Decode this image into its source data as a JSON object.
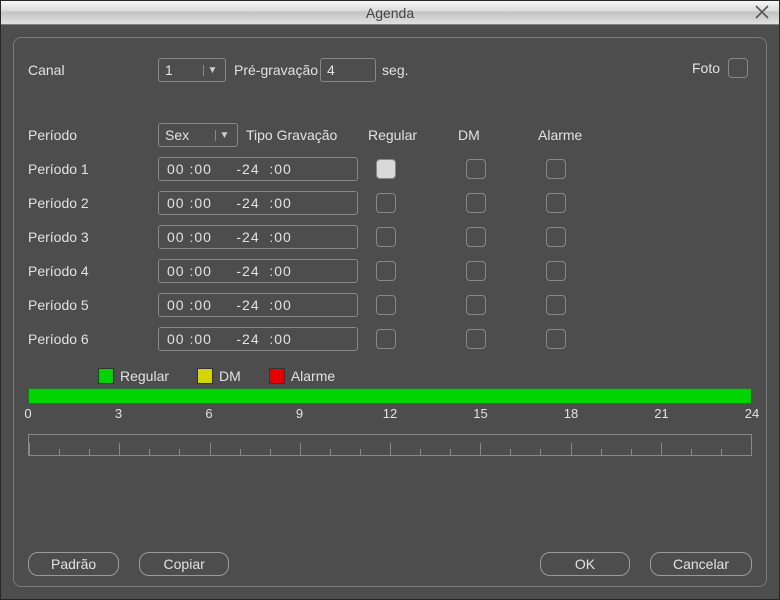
{
  "title": "Agenda",
  "top": {
    "channel_label": "Canal",
    "channel_value": "1",
    "prerec_label": "Pré-gravação",
    "prerec_value": "4",
    "prerec_unit": "seg.",
    "foto_label": "Foto",
    "foto_checked": false
  },
  "headers": {
    "periodo": "Período",
    "day_value": "Sex",
    "tipo": "Tipo Gravação",
    "regular": "Regular",
    "dm": "DM",
    "alarme": "Alarme"
  },
  "periods": [
    {
      "label": "Período 1",
      "time": "00 :00     -24  :00",
      "regular": true,
      "dm": false,
      "alarme": false
    },
    {
      "label": "Período 2",
      "time": "00 :00     -24  :00",
      "regular": false,
      "dm": false,
      "alarme": false
    },
    {
      "label": "Período 3",
      "time": "00 :00     -24  :00",
      "regular": false,
      "dm": false,
      "alarme": false
    },
    {
      "label": "Período 4",
      "time": "00 :00     -24  :00",
      "regular": false,
      "dm": false,
      "alarme": false
    },
    {
      "label": "Período 5",
      "time": "00 :00     -24  :00",
      "regular": false,
      "dm": false,
      "alarme": false
    },
    {
      "label": "Período 6",
      "time": "00 :00     -24  :00",
      "regular": false,
      "dm": false,
      "alarme": false
    }
  ],
  "legend": {
    "regular": "Regular",
    "dm": "DM",
    "alarme": "Alarme"
  },
  "timeline": {
    "ticks": [
      "0",
      "3",
      "6",
      "9",
      "12",
      "15",
      "18",
      "21",
      "24"
    ]
  },
  "buttons": {
    "padrao": "Padrão",
    "copiar": "Copiar",
    "ok": "OK",
    "cancelar": "Cancelar"
  }
}
